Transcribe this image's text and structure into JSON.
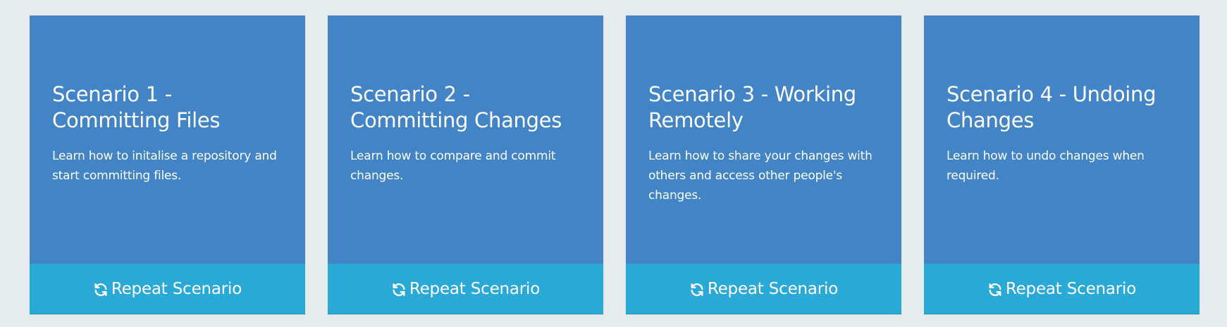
{
  "cards": [
    {
      "title": "Scenario 1 - Committing Files",
      "description": "Learn how to initalise a repository and start committing files.",
      "action_label": "Repeat Scenario",
      "action_icon": "refresh-icon"
    },
    {
      "title": "Scenario 2 - Committing Changes",
      "description": "Learn how to compare and commit changes.",
      "action_label": "Repeat Scenario",
      "action_icon": "refresh-icon"
    },
    {
      "title": "Scenario 3 - Working Remotely",
      "description": "Learn how to share your changes with others and access other people's changes.",
      "action_label": "Repeat Scenario",
      "action_icon": "refresh-icon"
    },
    {
      "title": "Scenario 4 - Undoing Changes",
      "description": "Learn how to undo changes when required.",
      "action_label": "Repeat Scenario",
      "action_icon": "refresh-icon"
    }
  ],
  "colors": {
    "page_background": "#e6eced",
    "card_background": "#4284c5",
    "action_background": "#2aa9d7",
    "text": "#ffffff"
  }
}
